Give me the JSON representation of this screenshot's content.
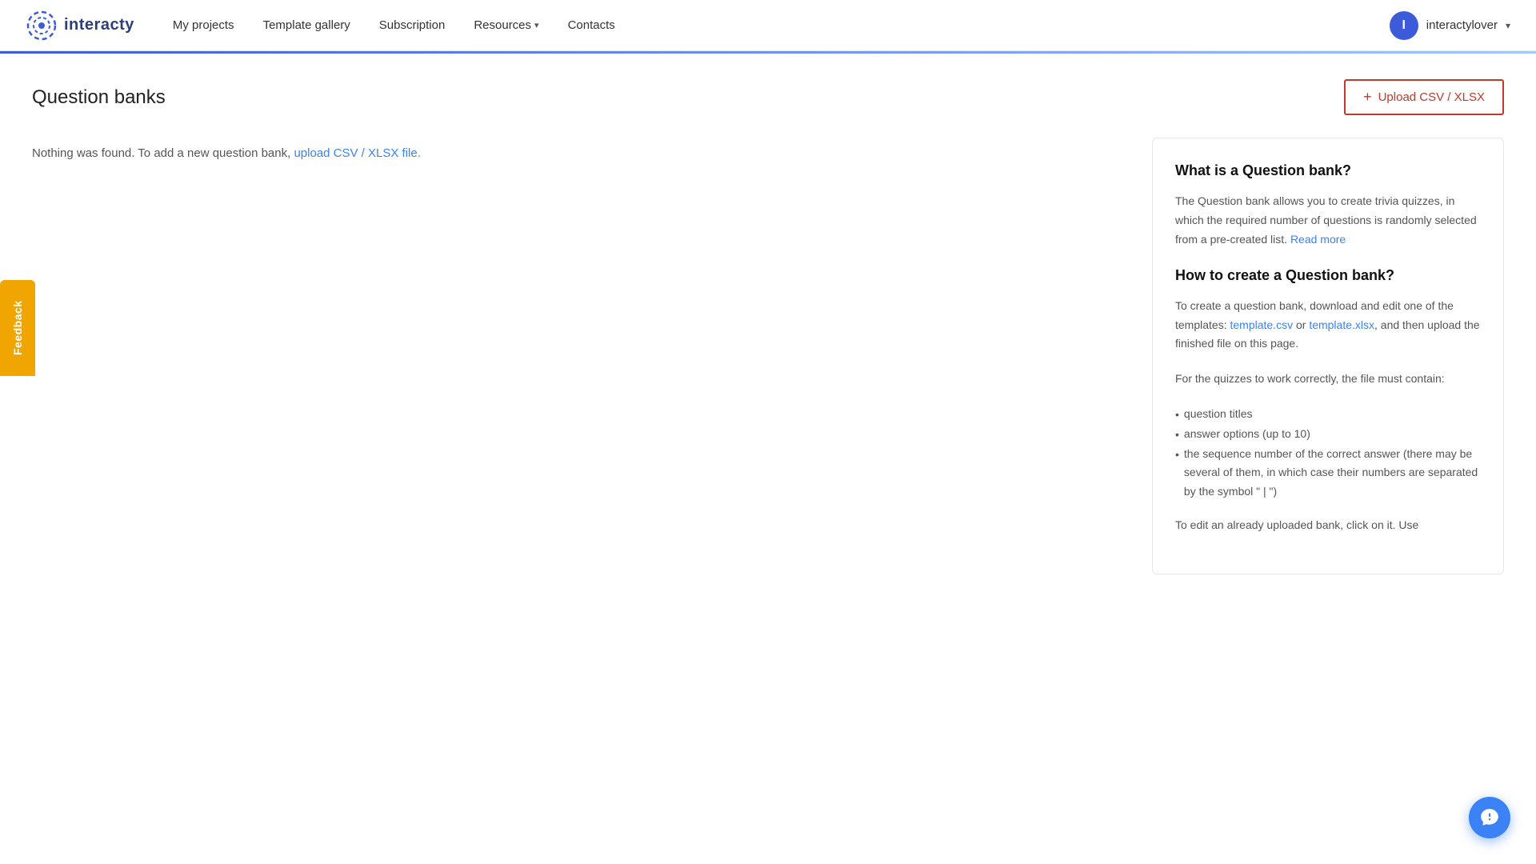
{
  "navbar": {
    "logo_text": "interacty",
    "nav_items": [
      {
        "label": "My projects",
        "has_dropdown": false
      },
      {
        "label": "Template gallery",
        "has_dropdown": false
      },
      {
        "label": "Subscription",
        "has_dropdown": false
      },
      {
        "label": "Resources",
        "has_dropdown": true
      },
      {
        "label": "Contacts",
        "has_dropdown": false
      }
    ],
    "user": {
      "initial": "I",
      "name": "interactylover",
      "chevron": "▾"
    }
  },
  "page": {
    "title": "Question banks",
    "upload_button_label": "Upload CSV / XLSХ",
    "upload_button_plus": "+"
  },
  "empty_state": {
    "message_prefix": "Nothing was found. To add a new question bank, ",
    "message_link": "upload CSV / XLSX file.",
    "message_suffix": ""
  },
  "info_panel": {
    "what_title": "What is a Question bank?",
    "what_body": "The Question bank allows you to create trivia quizzes, in which the required number of questions is randomly selected from a pre-created list. ",
    "what_link_text": "Read more",
    "how_title": "How to create a Question bank?",
    "how_intro": "To create a question bank, download and edit one of the templates: ",
    "how_link1": "template.csv",
    "how_or": " or ",
    "how_link2": "template.xlsx",
    "how_suffix": ", and then upload the finished file on this page.",
    "how_file_note": "For the quizzes to work correctly, the file must contain:",
    "how_list": [
      "question titles",
      "answer options (up to 10)",
      "the sequence number of the correct answer (there may be several of them, in which case their numbers are separated by the symbol \" | \")"
    ],
    "how_footer": "To edit an already uploaded bank, click on it. Use"
  },
  "feedback": {
    "label": "Feedback"
  }
}
